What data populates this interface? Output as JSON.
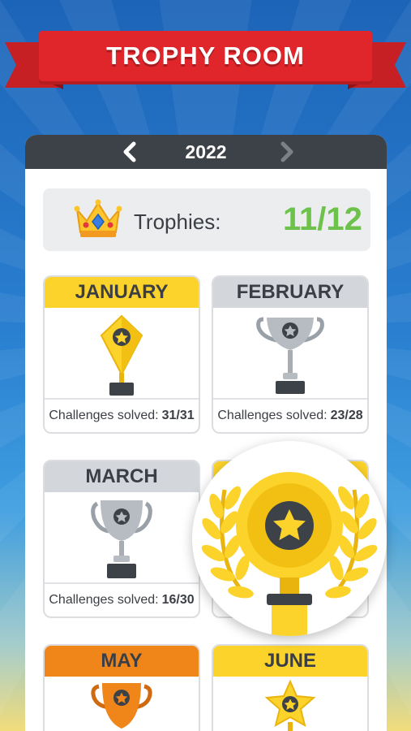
{
  "header": {
    "title": "TROPHY ROOM"
  },
  "year_nav": {
    "year": "2022",
    "prev_icon": "chevron-left-icon",
    "next_icon": "chevron-right-icon"
  },
  "summary": {
    "label": "Trophies:",
    "count": "11/12",
    "count_color": "#6cc24a",
    "icon": "crown-icon"
  },
  "months": [
    {
      "name": "JANUARY",
      "tier": "gold",
      "challenges_label": "Challenges solved:",
      "solved": "31/31"
    },
    {
      "name": "FEBRUARY",
      "tier": "silver",
      "challenges_label": "Challenges solved:",
      "solved": "23/28"
    },
    {
      "name": "MARCH",
      "tier": "silver",
      "challenges_label": "Challenges solved:",
      "solved": "16/30"
    },
    {
      "name": "MAY",
      "tier": "bronze"
    },
    {
      "name": "JUNE",
      "tier": "gold"
    }
  ],
  "colors": {
    "banner": "#e1262b",
    "gold": "#fbd32b",
    "silver": "#d3d6db",
    "bronze": "#f0861a",
    "dark": "#3d4249"
  }
}
